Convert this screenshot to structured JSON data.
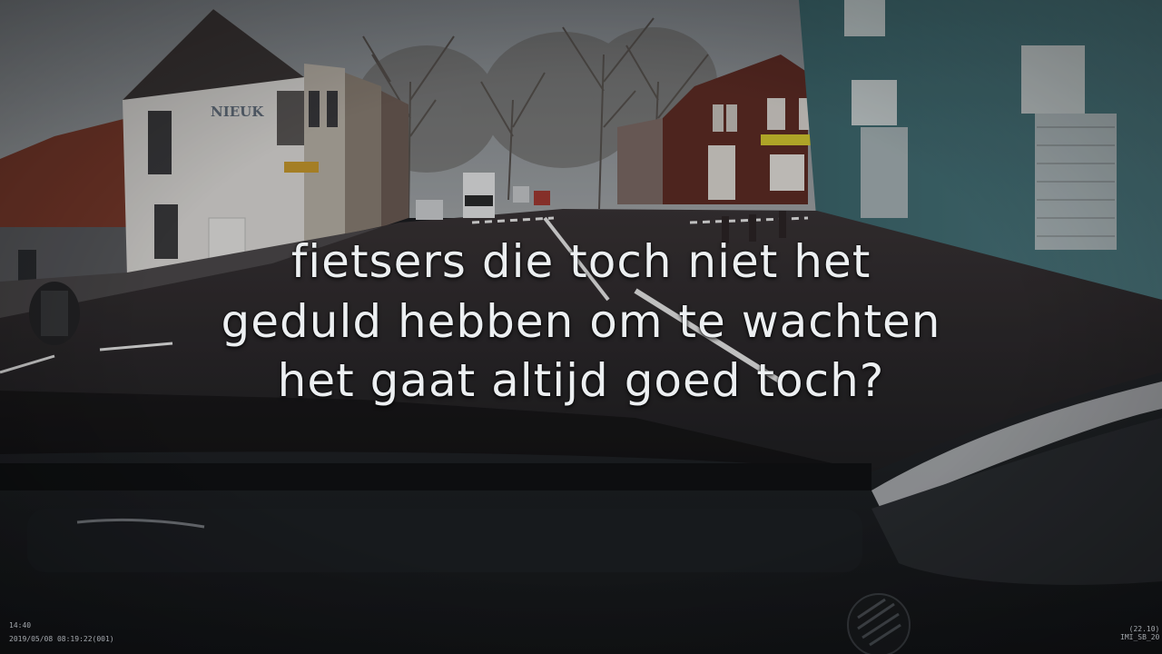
{
  "subtitle": {
    "line1": "fietsers die toch niet het",
    "line2": "geduld hebben om te wachten",
    "line3": "het gaat altijd goed toch?"
  },
  "building_sign": "NIEUK",
  "osd": {
    "left_time": "14:40",
    "left_stamp": "2019/05/08 08:19:22(001)",
    "right_value": "(22.10)",
    "right_code": "IMI_SB_20"
  },
  "colors": {
    "sky": "#8f9498",
    "road": "#2a2b2f",
    "teal_building": "#3f6d74",
    "white_building": "#dcdcdc",
    "brick": "#6a2f26",
    "dashboard": "#1c1f23"
  }
}
